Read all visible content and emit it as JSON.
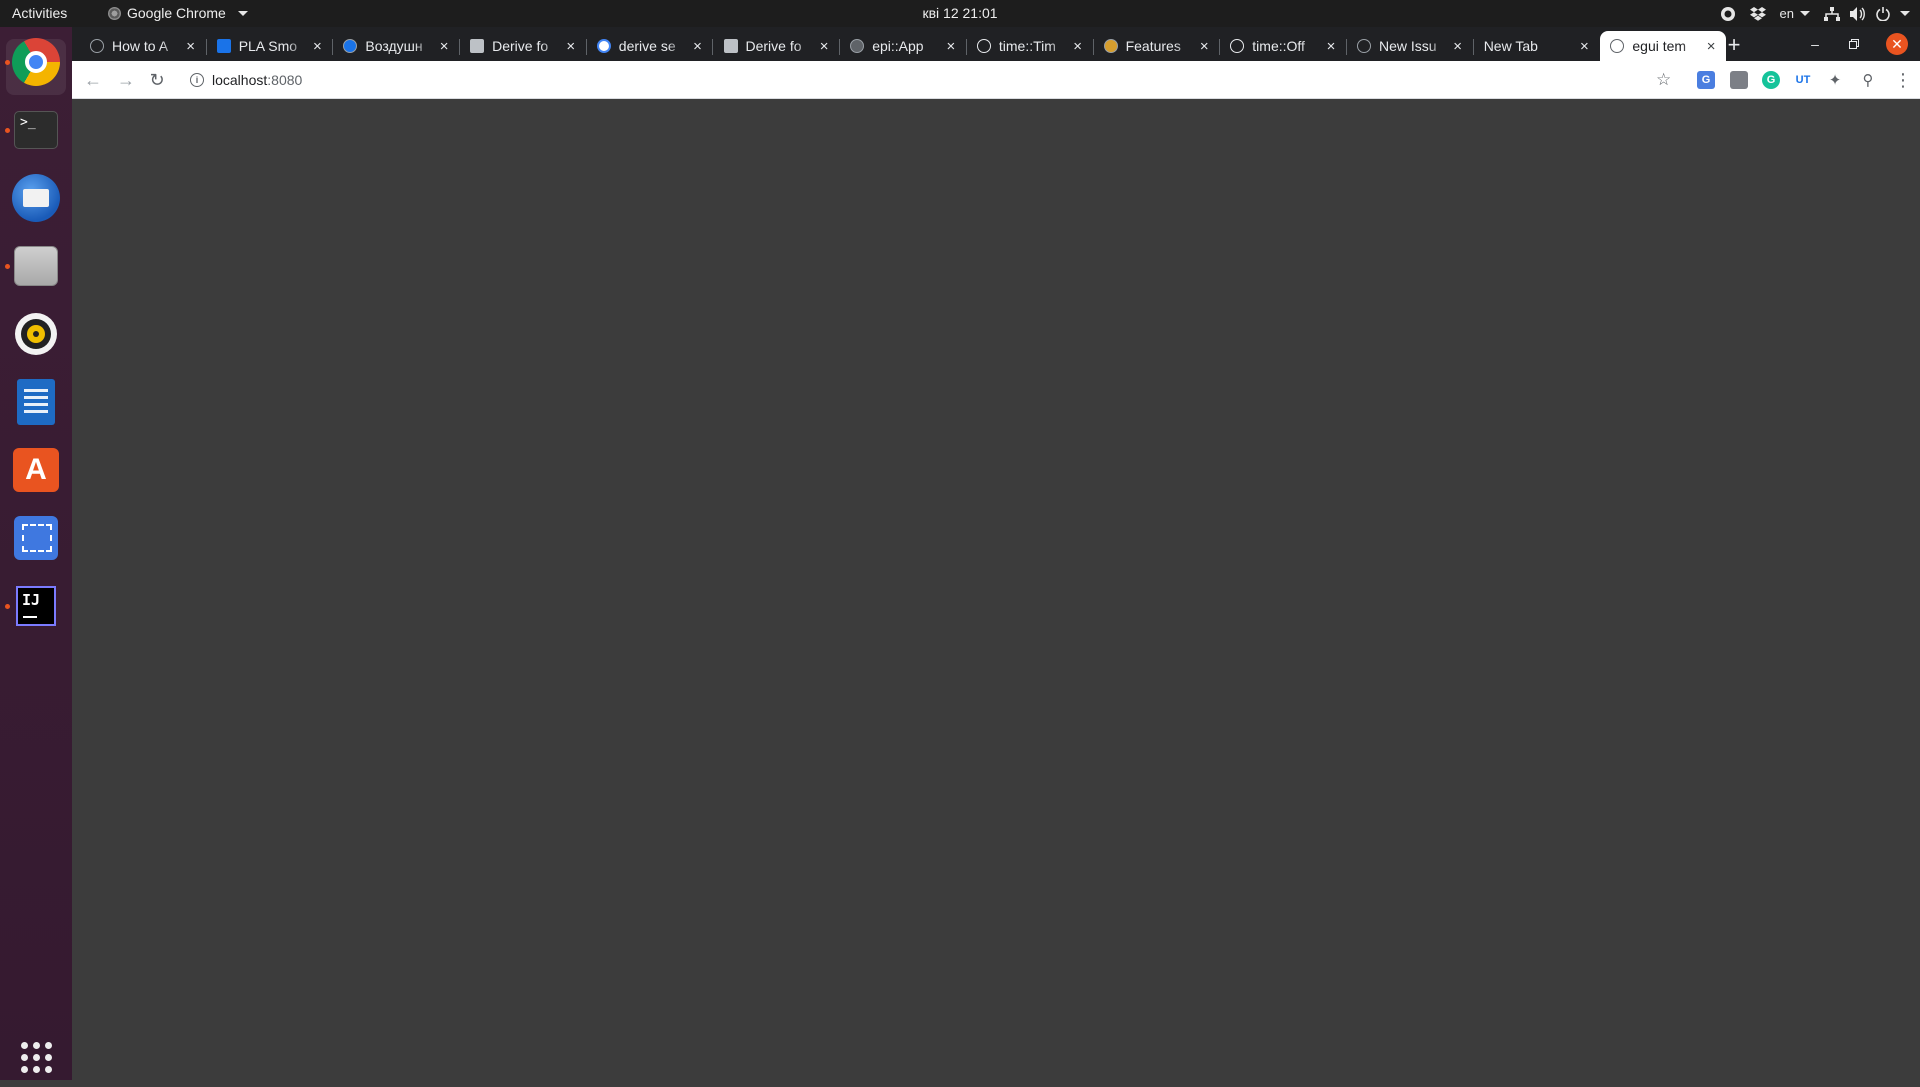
{
  "topbar": {
    "activities": "Activities",
    "app_name": "Google Chrome",
    "clock": "кві 12  21:01",
    "lang": "en"
  },
  "dock": {
    "items": [
      {
        "name": "google-chrome",
        "running": true,
        "active": true
      },
      {
        "name": "terminal",
        "running": true,
        "glyph": ">_"
      },
      {
        "name": "thunderbird",
        "running": false
      },
      {
        "name": "files",
        "running": true
      },
      {
        "name": "rhythmbox",
        "running": false
      },
      {
        "name": "libreoffice-writer",
        "running": false
      },
      {
        "name": "ubuntu-software",
        "running": false,
        "glyph": "A"
      },
      {
        "name": "screenshot",
        "running": false
      },
      {
        "name": "intellij-idea",
        "running": true,
        "glyph": "IJ"
      }
    ]
  },
  "browser": {
    "tabs": [
      {
        "title": "How to A",
        "favicon": "hexagon-dark",
        "color": "#202124"
      },
      {
        "title": "PLA Smo",
        "favicon": "3d-icon",
        "color": "#1a73e8"
      },
      {
        "title": "Воздушн",
        "favicon": "circle-blue",
        "color": "#1a73e8"
      },
      {
        "title": "Derive fo",
        "favicon": "book-icon",
        "color": "#5f6368"
      },
      {
        "title": "derive se",
        "favicon": "google-g",
        "color": "#4285f4"
      },
      {
        "title": "Derive fo",
        "favicon": "book-icon",
        "color": "#5f6368"
      },
      {
        "title": "epi::App",
        "favicon": "rust-docs",
        "color": "#5f6368"
      },
      {
        "title": "time::Tim",
        "favicon": "github-circle",
        "color": "#5f6368"
      },
      {
        "title": "Features",
        "favicon": "cargo-box",
        "color": "#d69e2e"
      },
      {
        "title": "time::Off",
        "favicon": "github-circle",
        "color": "#5f6368"
      },
      {
        "title": "New Issu",
        "favicon": "github-dark",
        "color": "#202124"
      },
      {
        "title": "New Tab",
        "favicon": "none",
        "color": "#202124"
      },
      {
        "title": "egui tem",
        "favicon": "globe-icon",
        "color": "#5f6368",
        "active": true
      }
    ],
    "address": {
      "host": "localhost",
      "port": ":8080"
    },
    "page_background": "#3c3c3c"
  },
  "colors": {
    "topbar": "#1d1d1d",
    "dock": "#3c1e35",
    "tabstrip": "#202124",
    "accent": "#e95420"
  }
}
